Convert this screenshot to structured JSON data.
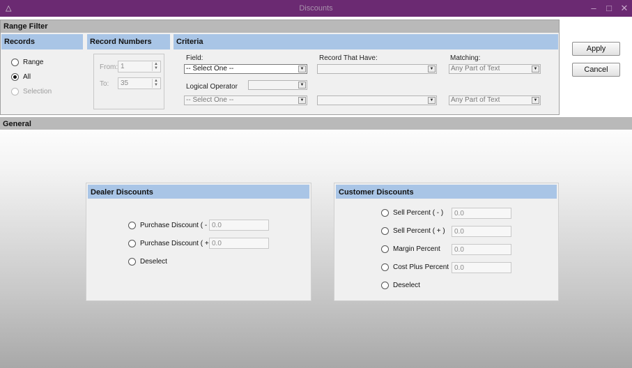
{
  "window": {
    "title": "Discounts",
    "icon": "app-logo-icon",
    "controls": {
      "minimize": "–",
      "maximize": "□",
      "close": "✕"
    }
  },
  "range_filter": {
    "header": "Range Filter",
    "records": {
      "title": "Records",
      "options": [
        {
          "label": "Range",
          "checked": false,
          "enabled": true
        },
        {
          "label": "All",
          "checked": true,
          "enabled": true
        },
        {
          "label": "Selection",
          "checked": false,
          "enabled": false
        }
      ]
    },
    "record_numbers": {
      "title": "Record Numbers",
      "from_label": "From:",
      "from_value": "1",
      "to_label": "To:",
      "to_value": "35"
    },
    "criteria": {
      "title": "Criteria",
      "field_label": "Field:",
      "record_that_have_label": "Record That Have:",
      "matching_label": "Matching:",
      "row1": {
        "field": "-- Select One --",
        "record_that_have": "",
        "matching": "Any Part of Text"
      },
      "logical_operator_label": "Logical Operator",
      "logical_operator_value": "",
      "row2": {
        "field": "-- Select One --",
        "record_that_have": "",
        "matching": "Any Part of Text"
      }
    }
  },
  "buttons": {
    "apply": "Apply",
    "cancel": "Cancel"
  },
  "general": {
    "header": "General",
    "dealer": {
      "title": "Dealer Discounts",
      "options": [
        {
          "label": "Purchase Discount ( - )",
          "value": "0.0"
        },
        {
          "label": "Purchase Discount ( + )",
          "value": "0.0"
        },
        {
          "label": "Deselect"
        }
      ]
    },
    "customer": {
      "title": "Customer Discounts",
      "options": [
        {
          "label": "Sell Percent ( - )",
          "value": "0.0"
        },
        {
          "label": "Sell Percent ( + )",
          "value": "0.0"
        },
        {
          "label": "Margin Percent",
          "value": "0.0"
        },
        {
          "label": "Cost Plus Percent",
          "value": "0.0"
        },
        {
          "label": "Deselect"
        }
      ]
    }
  },
  "colors": {
    "titlebar": "#6b2a72",
    "section_header": "#a9c5e6",
    "group_header": "#b9b9b9"
  }
}
